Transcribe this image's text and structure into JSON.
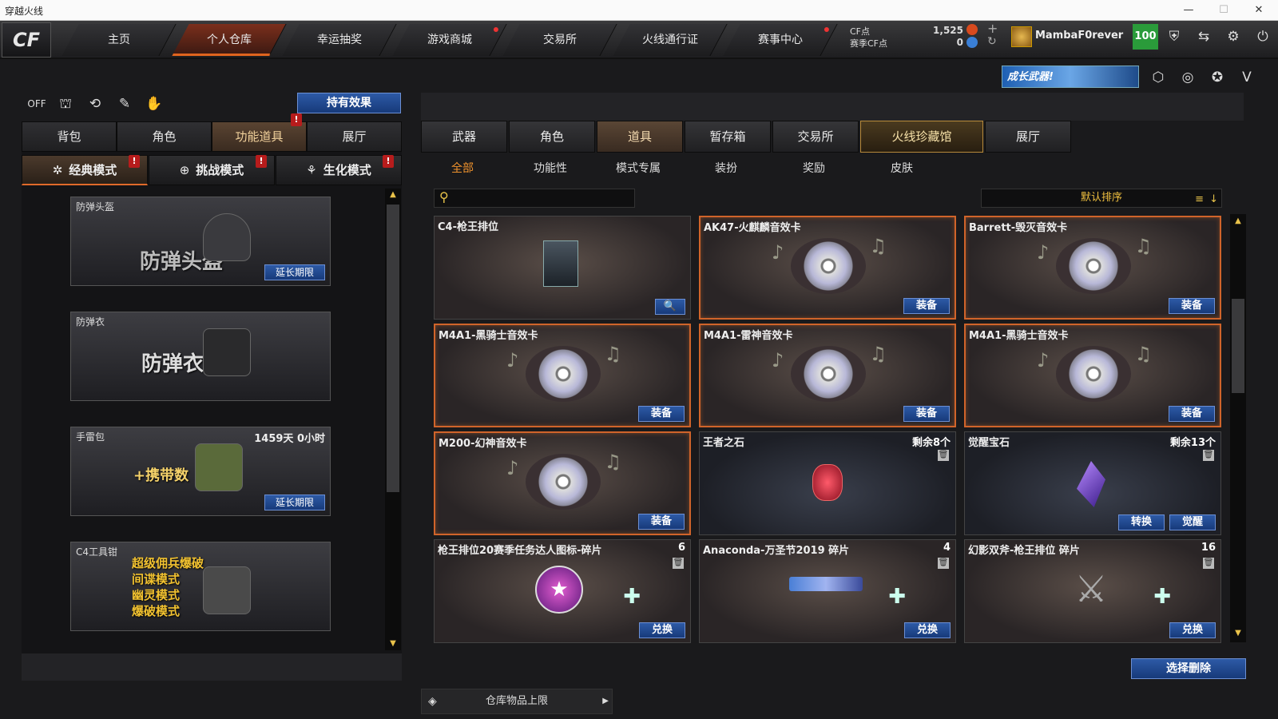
{
  "window": {
    "title": "穿越火线"
  },
  "nav": {
    "items": [
      "主页",
      "个人仓库",
      "幸运抽奖",
      "游戏商城",
      "交易所",
      "火线通行证",
      "赛事中心"
    ]
  },
  "currency": {
    "cf_label": "CF点",
    "cf_value": "1,525",
    "season_label": "赛季CF点",
    "season_value": "0"
  },
  "user": {
    "name": "MambaF0rever",
    "level": "100"
  },
  "banner": {
    "text": "成长武器!"
  },
  "left": {
    "hold_button": "持有效果",
    "tabs": [
      "背包",
      "角色",
      "功能道具",
      "展厅"
    ],
    "modes": [
      "经典模式",
      "挑战模式",
      "生化模式"
    ],
    "cards": [
      {
        "label": "防弹头盔",
        "overlay": "防弹头盔",
        "button": "延长期限",
        "duration": ""
      },
      {
        "label": "防弹衣",
        "overlay": "防弹衣",
        "button": "",
        "duration": ""
      },
      {
        "label": "手雷包",
        "overlay": "+携带数",
        "button": "延长期限",
        "duration": "1459天 0小时"
      },
      {
        "label": "C4工具钳",
        "overlay": "超级佣兵爆破\n间谍模式\n幽灵模式\n爆破模式",
        "button": "",
        "duration": ""
      }
    ]
  },
  "right": {
    "tabs": [
      "武器",
      "角色",
      "道具",
      "暂存箱",
      "交易所",
      "火线珍藏馆",
      "展厅"
    ],
    "subtabs": [
      "全部",
      "功能性",
      "模式专属",
      "装扮",
      "奖励",
      "皮肤"
    ],
    "sort": "默认排序",
    "items": [
      {
        "name": "C4-枪王排位",
        "count": "",
        "btn": "🔍",
        "btn2": "",
        "kind": "c4"
      },
      {
        "name": "AK47-火麒麟音效卡",
        "count": "",
        "btn": "装备",
        "btn2": "",
        "kind": "disc"
      },
      {
        "name": "Barrett-毁灭音效卡",
        "count": "",
        "btn": "装备",
        "btn2": "",
        "kind": "disc"
      },
      {
        "name": "M4A1-黑骑士音效卡",
        "count": "",
        "btn": "装备",
        "btn2": "",
        "kind": "disc"
      },
      {
        "name": "M4A1-雷神音效卡",
        "count": "",
        "btn": "装备",
        "btn2": "",
        "kind": "disc"
      },
      {
        "name": "M4A1-黑骑士音效卡",
        "count": "",
        "btn": "装备",
        "btn2": "",
        "kind": "disc"
      },
      {
        "name": "M200-幻神音效卡",
        "count": "",
        "btn": "装备",
        "btn2": "",
        "kind": "disc"
      },
      {
        "name": "王者之石",
        "count": "剩余8个",
        "btn": "",
        "btn2": "",
        "kind": "ruby"
      },
      {
        "name": "觉醒宝石",
        "count": "剩余13个",
        "btn": "觉醒",
        "btn2": "转换",
        "kind": "gem"
      },
      {
        "name": "枪王排位20赛季任务达人图标-碎片",
        "count": "6",
        "btn": "兑换",
        "btn2": "",
        "kind": "badge"
      },
      {
        "name": "Anaconda-万圣节2019 碎片",
        "count": "4",
        "btn": "兑换",
        "btn2": "",
        "kind": "gun"
      },
      {
        "name": "幻影双斧-枪王排位 碎片",
        "count": "16",
        "btn": "兑换",
        "btn2": "",
        "kind": "axe"
      }
    ],
    "delete_button": "选择删除",
    "storage": "仓库物品上限"
  }
}
